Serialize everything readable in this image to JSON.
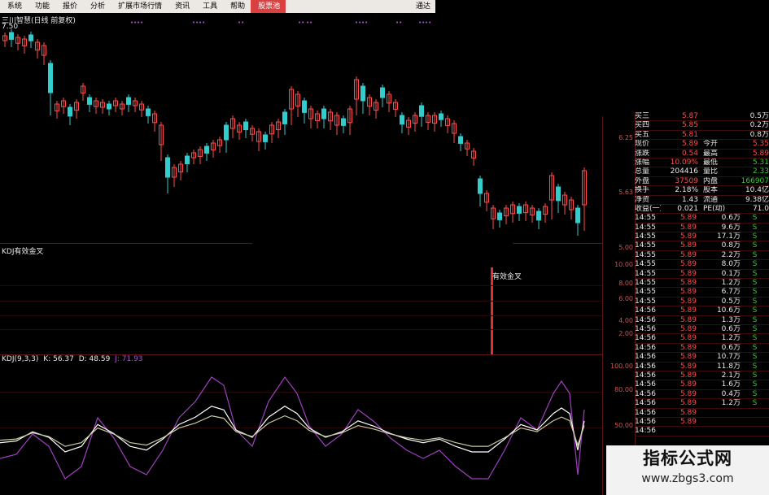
{
  "menu": {
    "items": [
      "系统",
      "功能",
      "报价",
      "分析",
      "扩展市场行情",
      "资讯",
      "工具",
      "帮助",
      "股票池"
    ],
    "active_index": 8,
    "right_label": "通达"
  },
  "chart": {
    "title": "三川智慧(日线 前复权)",
    "top_price": "7.50",
    "price_axis": [
      "6.25",
      "5.63",
      "5.00"
    ],
    "indicator1_title": "KDJ有效金叉",
    "indicator1_signal": "有效金叉",
    "indicator1_axis": [
      "10.00",
      "8.00",
      "6.00",
      "4.00",
      "2.00"
    ],
    "kdj_title": "KDJ(9,3,3)",
    "kdj_k": "K: 56.37",
    "kdj_d": "D: 48.59",
    "kdj_j": "J: 71.93",
    "kdj_axis": [
      "100.00",
      "80.00",
      "50.00"
    ]
  },
  "quote_top": [
    {
      "name": "买三",
      "val": "5.87",
      "val_color": "red",
      "k2": "",
      "v2": "0.5万"
    },
    {
      "name": "买四",
      "val": "5.85",
      "val_color": "red",
      "k2": "",
      "v2": "0.2万"
    },
    {
      "name": "买五",
      "val": "5.81",
      "val_color": "red",
      "k2": "",
      "v2": "0.8万"
    },
    {
      "name": "现价",
      "val": "5.89",
      "val_color": "red",
      "k2": "今开",
      "v2": "5.35"
    },
    {
      "name": "涨跌",
      "val": "0.54",
      "val_color": "red",
      "k2": "最高",
      "v2": "5.89"
    },
    {
      "name": "涨幅",
      "val": "10.09%",
      "val_color": "red",
      "k2": "最低",
      "v2": "5.31"
    },
    {
      "name": "总量",
      "val": "204416",
      "val_color": "white",
      "k2": "量比",
      "v2": "2.33"
    },
    {
      "name": "外盘",
      "val": "37509",
      "val_color": "red",
      "k2": "内盘",
      "v2": "166907"
    },
    {
      "name": "换手",
      "val": "2.18%",
      "val_color": "white",
      "k2": "股本",
      "v2": "10.4亿"
    },
    {
      "name": "净资",
      "val": "1.43",
      "val_color": "white",
      "k2": "流通",
      "v2": "9.38亿"
    },
    {
      "name": "收益(一)",
      "val": "0.021",
      "val_color": "white",
      "k2": "PE(动)",
      "v2": "71.0"
    }
  ],
  "ticks": [
    {
      "t": "14:55",
      "p": "5.89",
      "v": "0.6万",
      "f": "S"
    },
    {
      "t": "14:55",
      "p": "5.89",
      "v": "9.6万",
      "f": "S"
    },
    {
      "t": "14:55",
      "p": "5.89",
      "v": "17.1万",
      "f": "S"
    },
    {
      "t": "14:55",
      "p": "5.89",
      "v": "0.8万",
      "f": "S"
    },
    {
      "t": "14:55",
      "p": "5.89",
      "v": "2.2万",
      "f": "S"
    },
    {
      "t": "14:55",
      "p": "5.89",
      "v": "8.0万",
      "f": "S"
    },
    {
      "t": "14:55",
      "p": "5.89",
      "v": "0.1万",
      "f": "S"
    },
    {
      "t": "14:55",
      "p": "5.89",
      "v": "1.2万",
      "f": "S"
    },
    {
      "t": "14:55",
      "p": "5.89",
      "v": "6.7万",
      "f": "S"
    },
    {
      "t": "14:55",
      "p": "5.89",
      "v": "0.5万",
      "f": "S"
    },
    {
      "t": "14:56",
      "p": "5.89",
      "v": "10.6万",
      "f": "S"
    },
    {
      "t": "14:56",
      "p": "5.89",
      "v": "1.3万",
      "f": "S"
    },
    {
      "t": "14:56",
      "p": "5.89",
      "v": "0.6万",
      "f": "S"
    },
    {
      "t": "14:56",
      "p": "5.89",
      "v": "1.2万",
      "f": "S"
    },
    {
      "t": "14:56",
      "p": "5.89",
      "v": "0.6万",
      "f": "S"
    },
    {
      "t": "14:56",
      "p": "5.89",
      "v": "10.7万",
      "f": "S"
    },
    {
      "t": "14:56",
      "p": "5.89",
      "v": "11.8万",
      "f": "S"
    },
    {
      "t": "14:56",
      "p": "5.89",
      "v": "2.1万",
      "f": "S"
    },
    {
      "t": "14:56",
      "p": "5.89",
      "v": "1.6万",
      "f": "S"
    },
    {
      "t": "14:56",
      "p": "5.89",
      "v": "0.4万",
      "f": "S"
    },
    {
      "t": "14:56",
      "p": "5.89",
      "v": "1.2万",
      "f": "S"
    },
    {
      "t": "14:56",
      "p": "5.89",
      "v": "",
      "f": ""
    },
    {
      "t": "14:56",
      "p": "5.89",
      "v": "",
      "f": ""
    },
    {
      "t": "14:56",
      "p": "",
      "v": "",
      "f": ""
    }
  ],
  "watermark": {
    "title": "指标公式网",
    "url": "www.zbgs3.com"
  },
  "colors": {
    "up": "#ff4d4d",
    "down": "#33cccc",
    "k": "#ffffff",
    "d": "#c8c8a0",
    "j": "#a040c0"
  }
}
